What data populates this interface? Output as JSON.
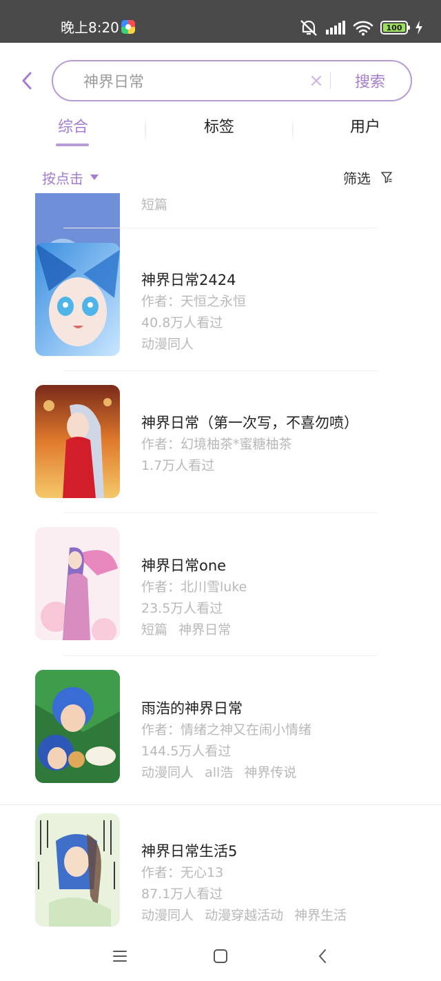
{
  "status_bar": {
    "time": "晚上8:20",
    "battery": "100",
    "icons": [
      "app-icon",
      "mute-icon",
      "signal-icon",
      "wifi-icon",
      "battery-icon",
      "charging-icon"
    ]
  },
  "search": {
    "value": "神界日常",
    "button_label": "搜索"
  },
  "tabs": [
    {
      "label": "综合",
      "active": true
    },
    {
      "label": "标签",
      "active": false
    },
    {
      "label": "用户",
      "active": false
    }
  ],
  "sort": {
    "label": "按点击"
  },
  "filter": {
    "label": "筛选"
  },
  "partial_item": {
    "tags": [
      "短篇"
    ]
  },
  "items": [
    {
      "title": "神界日常2424",
      "author": "作者：天恒之永恒",
      "views": "40.8万人看过",
      "tags": [
        "动漫同人"
      ]
    },
    {
      "title": "神界日常（第一次写，不喜勿喷）",
      "author": "作者：幻境柚茶*蜜糖柚茶",
      "views": "1.7万人看过",
      "tags": []
    },
    {
      "title": "神界日常one",
      "author": "作者：北川雪luke",
      "views": "23.5万人看过",
      "tags": [
        "短篇",
        "神界日常"
      ]
    },
    {
      "title": "雨浩的神界日常",
      "author": "作者：情绪之神又在闹小情绪",
      "views": "144.5万人看过",
      "tags": [
        "动漫同人",
        "all浩",
        "神界传说"
      ]
    },
    {
      "title": "神界日常生活5",
      "author": "作者：无心13",
      "views": "87.1万人看过",
      "tags": [
        "动漫同人",
        "动漫穿越活动",
        "神界生活"
      ]
    }
  ],
  "colors": {
    "accent": "#a57cd1",
    "accent_border": "#b79ad6",
    "status_bar": "#4a4a4a",
    "meta_text": "#b8b8b8"
  }
}
